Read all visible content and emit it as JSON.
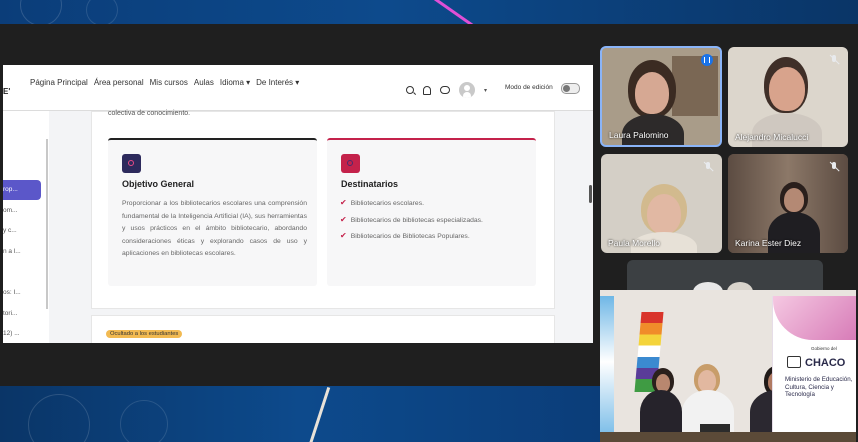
{
  "browser": {
    "brand": "E'",
    "nav": [
      "Página Principal",
      "Área personal",
      "Mis cursos",
      "Aulas",
      "Idioma ▾",
      "De Interés ▾"
    ],
    "edit_mode_label": "Modo de edición",
    "sidebar_items": [
      "rop...",
      "om...",
      "y c...",
      "n a l...",
      "os: I...",
      "tori...",
      "12) ..."
    ],
    "intro_fragment": "colectiva de conocimiento.",
    "card1": {
      "title": "Objetivo General",
      "body": "Proporcionar a los bibliotecarios escolares una comprensión fundamental de la Inteligencia Artificial (IA), sus herramientas y usos prácticos en el ámbito bibliotecario, abordando consideraciones éticas y explorando casos de uso y aplicaciones en bibliotecas escolares."
    },
    "card2": {
      "title": "Destinatarios",
      "items": [
        "Bibliotecarios escolares.",
        "Bibliotecarios de bibliotecas especializadas.",
        "Bibliotecarios de Bibliotecas Populares."
      ]
    },
    "hidden_badge": "Ocultado a los estudiantes"
  },
  "participants": [
    {
      "name": "Laura Palomino",
      "state": "speaking"
    },
    {
      "name": "Alejandro Micalucci",
      "state": "muted"
    },
    {
      "name": "Paula Morello",
      "state": "muted"
    },
    {
      "name": "Karina Ester Diez",
      "state": "muted"
    }
  ],
  "room": {
    "banner_top": "Gobierno del",
    "banner_brand": "CHACO",
    "banner_ministry": "Ministerio de Educación, Cultura, Ciencia y Tecnología"
  },
  "colors": {
    "accent": "#5b57c9",
    "destinatarios": "#c4224b",
    "badge": "#f2ba52",
    "speaking": "#1a73e8"
  }
}
